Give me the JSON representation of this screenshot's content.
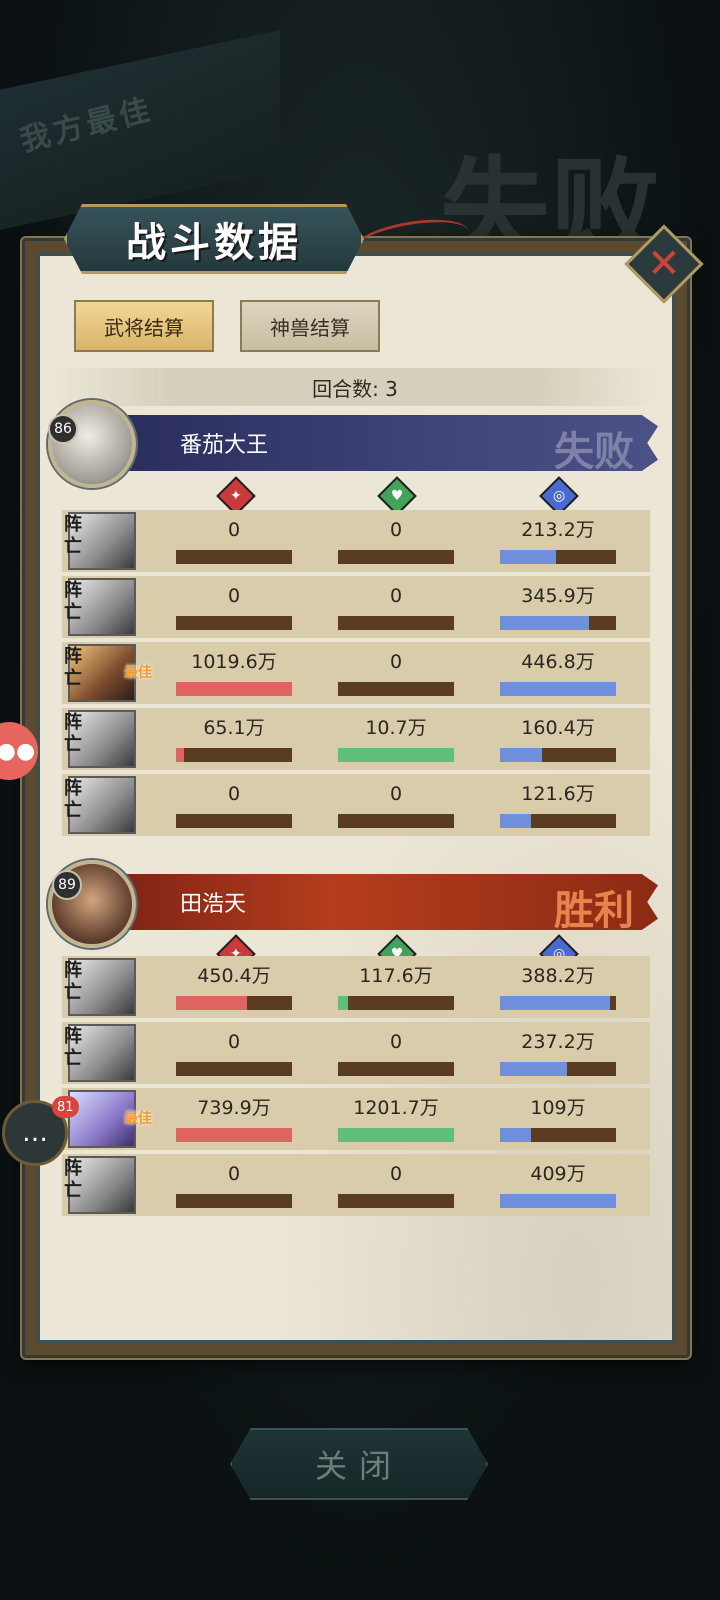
{
  "title": "战斗数据",
  "background": {
    "best_label": "我方最佳",
    "result_label": "失败"
  },
  "tabs": [
    {
      "label": "武将结算",
      "active": true
    },
    {
      "label": "神兽结算",
      "active": false
    }
  ],
  "round": {
    "label": "回合数: 3"
  },
  "icons": {
    "attack": "attack-icon",
    "heal": "heal-icon",
    "defense": "defense-icon",
    "close": "close-icon",
    "chat": "chat-icon"
  },
  "colors": {
    "attack_bar": "#df6360",
    "heal_bar": "#5fbe78",
    "defense_bar": "#6f90dc",
    "bar_bg": "#5a3d20"
  },
  "teams": [
    {
      "name": "番茄大王",
      "level": "86",
      "result": "失败",
      "rows": [
        {
          "status": "阵亡",
          "best": "",
          "atk": "0",
          "heal": "0",
          "def": "213.2万",
          "atk_pct": 0,
          "heal_pct": 0,
          "def_pct": 48
        },
        {
          "status": "阵亡",
          "best": "",
          "atk": "0",
          "heal": "0",
          "def": "345.9万",
          "atk_pct": 0,
          "heal_pct": 0,
          "def_pct": 77
        },
        {
          "status": "阵亡",
          "best": "最佳",
          "atk": "1019.6万",
          "heal": "0",
          "def": "446.8万",
          "atk_pct": 100,
          "heal_pct": 0,
          "def_pct": 100
        },
        {
          "status": "阵亡",
          "best": "",
          "atk": "65.1万",
          "heal": "10.7万",
          "def": "160.4万",
          "atk_pct": 7,
          "heal_pct": 100,
          "def_pct": 36
        },
        {
          "status": "阵亡",
          "best": "",
          "atk": "0",
          "heal": "0",
          "def": "121.6万",
          "atk_pct": 0,
          "heal_pct": 0,
          "def_pct": 27
        }
      ]
    },
    {
      "name": "田浩天",
      "level": "89",
      "result": "胜利",
      "rows": [
        {
          "status": "阵亡",
          "best": "",
          "atk": "450.4万",
          "heal": "117.6万",
          "def": "388.2万",
          "atk_pct": 61,
          "heal_pct": 9,
          "def_pct": 95
        },
        {
          "status": "阵亡",
          "best": "",
          "atk": "0",
          "heal": "0",
          "def": "237.2万",
          "atk_pct": 0,
          "heal_pct": 0,
          "def_pct": 58
        },
        {
          "status": "",
          "best": "最佳",
          "atk": "739.9万",
          "heal": "1201.7万",
          "def": "109万",
          "atk_pct": 100,
          "heal_pct": 100,
          "def_pct": 27
        },
        {
          "status": "阵亡",
          "best": "",
          "atk": "0",
          "heal": "0",
          "def": "409万",
          "atk_pct": 0,
          "heal_pct": 0,
          "def_pct": 100
        }
      ]
    }
  ],
  "chat": {
    "count": "81"
  },
  "bottom_button": {
    "label": "关闭"
  }
}
